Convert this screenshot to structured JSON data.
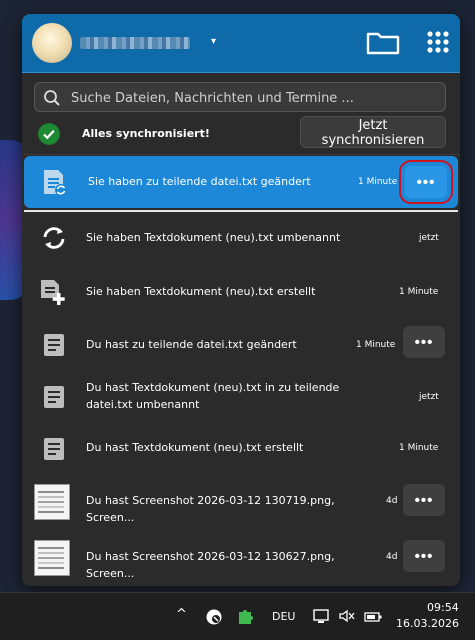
{
  "header": {
    "user_caret": "▾",
    "folder_icon": "folder-icon",
    "apps_icon": "apps-grid-icon"
  },
  "search": {
    "placeholder": "Suche Dateien, Nachrichten und Termine ..."
  },
  "status": {
    "text": "Alles synchronisiert!",
    "sync_button": "Jetzt synchronisieren",
    "icon": "check-circle-icon"
  },
  "activities": [
    {
      "text": "Sie haben zu teilende datei.txt geändert",
      "time": "1 Minute",
      "icon": "file-sync-icon",
      "more": "•••",
      "active": true
    },
    {
      "text": "Sie haben Textdokument (neu).txt umbenannt",
      "time": "jetzt",
      "icon": "rename-sync-icon"
    },
    {
      "text": "Sie haben Textdokument (neu).txt erstellt",
      "time": "1 Minute",
      "icon": "file-add-icon"
    },
    {
      "text": "Du hast zu teilende datei.txt geändert",
      "time": "1 Minute",
      "icon": "file-text-icon",
      "more": "•••"
    },
    {
      "text": "Du hast Textdokument (neu).txt in zu teilende datei.txt umbenannt",
      "time": "jetzt",
      "icon": "file-text-icon"
    },
    {
      "text": "Du hast Textdokument (neu).txt erstellt",
      "time": "1 Minute",
      "icon": "file-text-icon"
    },
    {
      "text": "Du hast Screenshot 2026-03-12 130719.png, Screen...",
      "time": "4d",
      "icon": "image-thumbnail",
      "more": "•••"
    },
    {
      "text": "Du hast Screenshot 2026-03-12 130627.png, Screen...",
      "time": "4d",
      "icon": "image-thumbnail",
      "more": "•••"
    }
  ],
  "taskbar": {
    "chevron": "^",
    "language": "DEU",
    "time": "09:54",
    "date": "16.03.2026"
  },
  "colors": {
    "header": "#0e6aa8",
    "active_row": "#1d88d8",
    "panel": "#2b2b2b",
    "highlight_box": "#d0121e"
  }
}
